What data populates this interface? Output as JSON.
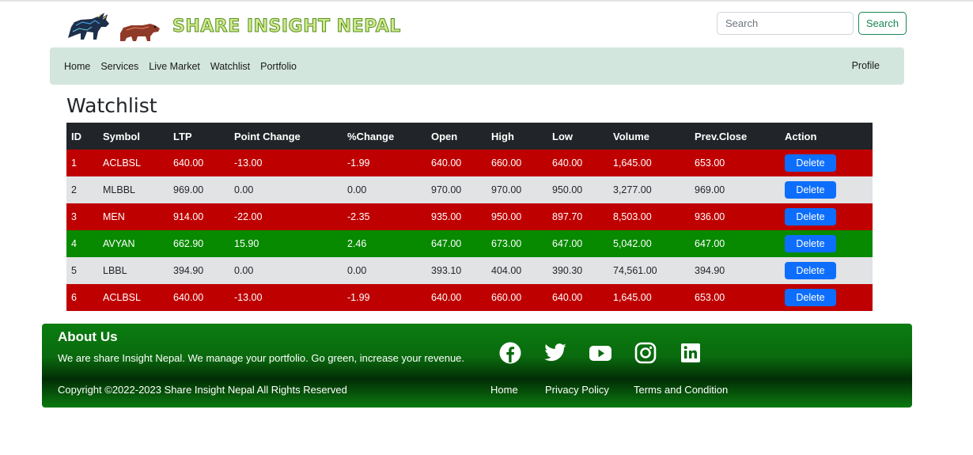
{
  "brand": {
    "name": "SHARE INSIGHT NEPAL",
    "logo_icon": "bull-bear-logo-icon"
  },
  "search": {
    "placeholder": "Search",
    "button_label": "Search"
  },
  "nav": {
    "links": [
      "Home",
      "Services",
      "Live Market",
      "Watchlist",
      "Portfolio"
    ],
    "profile": "Profile"
  },
  "page": {
    "title": "Watchlist"
  },
  "table": {
    "headers": [
      "ID",
      "Symbol",
      "LTP",
      "Point Change",
      "%Change",
      "Open",
      "High",
      "Low",
      "Volume",
      "Prev.Close",
      "Action"
    ],
    "rows": [
      {
        "id": "1",
        "symbol": "ACLBSL",
        "ltp": "640.00",
        "point_change": "-13.00",
        "pct_change": "-1.99",
        "open": "640.00",
        "high": "660.00",
        "low": "640.00",
        "volume": "1,645.00",
        "prev_close": "653.00",
        "action": "Delete",
        "status": "down"
      },
      {
        "id": "2",
        "symbol": "MLBBL",
        "ltp": "969.00",
        "point_change": "0.00",
        "pct_change": "0.00",
        "open": "970.00",
        "high": "970.00",
        "low": "950.00",
        "volume": "3,277.00",
        "prev_close": "969.00",
        "action": "Delete",
        "status": "unchanged"
      },
      {
        "id": "3",
        "symbol": "MEN",
        "ltp": "914.00",
        "point_change": "-22.00",
        "pct_change": "-2.35",
        "open": "935.00",
        "high": "950.00",
        "low": "897.70",
        "volume": "8,503.00",
        "prev_close": "936.00",
        "action": "Delete",
        "status": "down"
      },
      {
        "id": "4",
        "symbol": "AVYAN",
        "ltp": "662.90",
        "point_change": "15.90",
        "pct_change": "2.46",
        "open": "647.00",
        "high": "673.00",
        "low": "647.00",
        "volume": "5,042.00",
        "prev_close": "647.00",
        "action": "Delete",
        "status": "up"
      },
      {
        "id": "5",
        "symbol": "LBBL",
        "ltp": "394.90",
        "point_change": "0.00",
        "pct_change": "0.00",
        "open": "393.10",
        "high": "404.00",
        "low": "390.30",
        "volume": "74,561.00",
        "prev_close": "394.90",
        "action": "Delete",
        "status": "unchanged"
      },
      {
        "id": "6",
        "symbol": "ACLBSL",
        "ltp": "640.00",
        "point_change": "-13.00",
        "pct_change": "-1.99",
        "open": "640.00",
        "high": "660.00",
        "low": "640.00",
        "volume": "1,645.00",
        "prev_close": "653.00",
        "action": "Delete",
        "status": "down"
      }
    ]
  },
  "footer": {
    "about_title": "About Us",
    "about_text": "We are share Insight Nepal. We manage your portfolio. Go green, increase your revenue.",
    "copyright": "Copyright ©2022-2023 Share Insight Nepal All Rights Reserved",
    "social_icons": [
      "facebook-icon",
      "twitter-icon",
      "youtube-icon",
      "instagram-icon",
      "linkedin-icon"
    ],
    "links": [
      "Home",
      "Privacy Policy",
      "Terms and Condition"
    ]
  },
  "colors": {
    "down": "#bf0000",
    "up": "#078a00",
    "unchanged": "#e2e3e5",
    "navbar": "#d3e6dd",
    "delete_button": "#0d6efd",
    "footer": "#0a6a0e"
  }
}
